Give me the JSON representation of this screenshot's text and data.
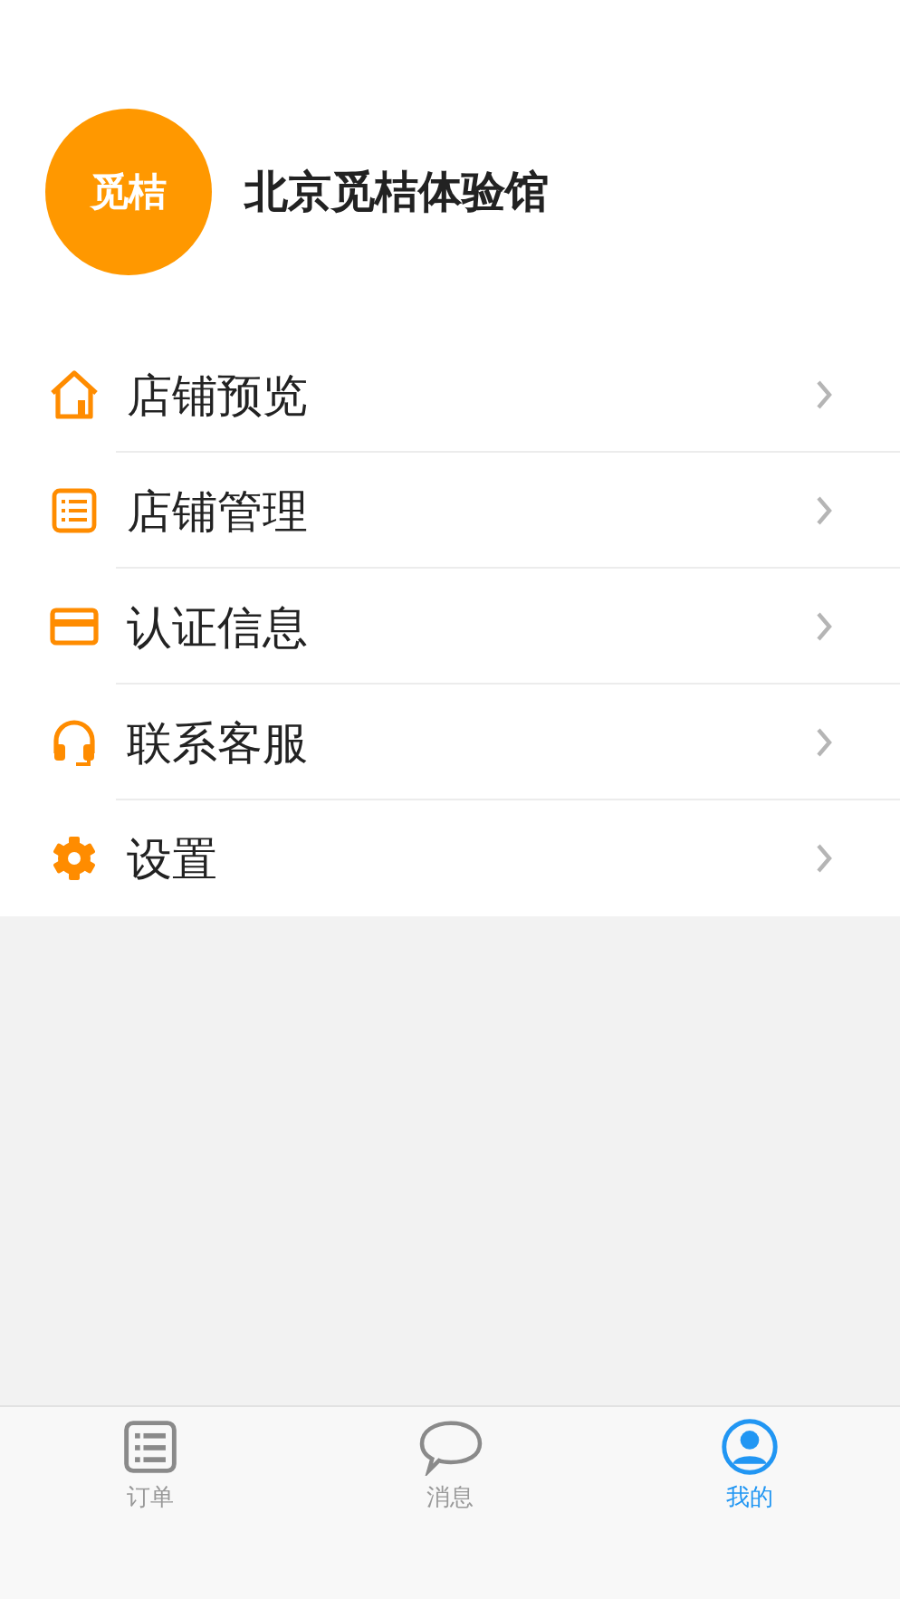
{
  "profile": {
    "avatar_text": "觅桔",
    "name": "北京觅桔体验馆"
  },
  "menu": [
    {
      "kind": "house",
      "label": "店铺预览"
    },
    {
      "kind": "list",
      "label": "店铺管理"
    },
    {
      "kind": "card",
      "label": "认证信息"
    },
    {
      "kind": "headset",
      "label": "联系客服"
    },
    {
      "kind": "gear",
      "label": "设置"
    }
  ],
  "tabs": [
    {
      "kind": "list",
      "label": "订单",
      "selected": false
    },
    {
      "kind": "chat",
      "label": "消息",
      "selected": false
    },
    {
      "kind": "user",
      "label": "我的",
      "selected": true
    }
  ]
}
